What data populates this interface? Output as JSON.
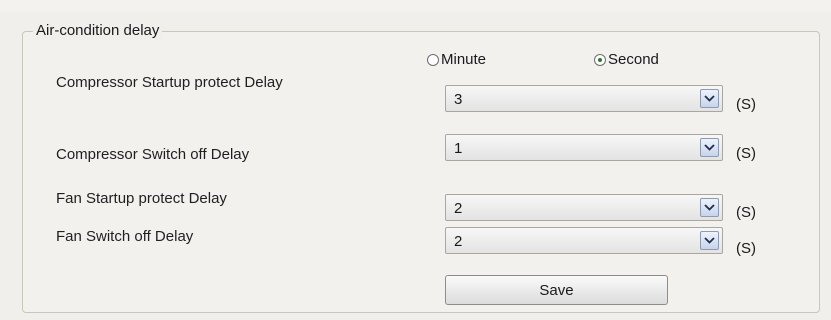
{
  "group": {
    "title": "Air-condition delay"
  },
  "time_unit": {
    "options": [
      {
        "label": "Minute",
        "selected": false
      },
      {
        "label": "Second",
        "selected": true
      }
    ]
  },
  "rows": [
    {
      "label": "Compressor Startup protect Delay",
      "value": "3",
      "unit": "(S)"
    },
    {
      "label": "Compressor Switch off Delay",
      "value": "1",
      "unit": "(S)"
    },
    {
      "label": "Fan Startup protect  Delay",
      "value": "2",
      "unit": "(S)"
    },
    {
      "label": "Fan Switch off Delay",
      "value": "2",
      "unit": "(S)"
    }
  ],
  "save_label": "Save",
  "icons": {
    "dropdown": "chevron-down-icon",
    "radio_unchecked": "radio-unchecked-icon",
    "radio_checked": "radio-checked-icon"
  }
}
